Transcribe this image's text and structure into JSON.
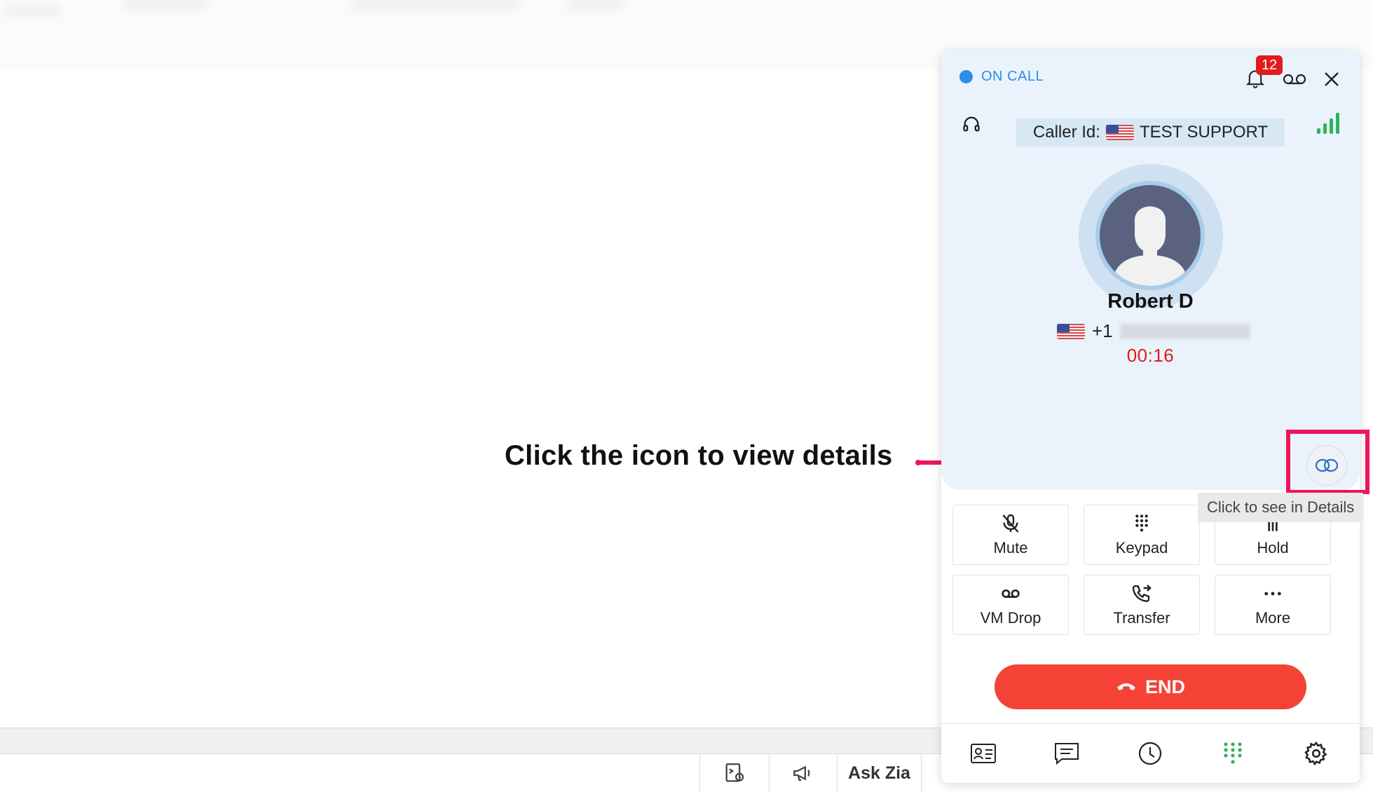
{
  "background": {
    "bottombar": {
      "ask_zia": "Ask Zia"
    }
  },
  "annotation": {
    "text": "Click the icon to view details",
    "color": "#f0145a"
  },
  "phone_panel": {
    "status": {
      "label": "ON CALL",
      "color": "#2b8de6"
    },
    "notifications": {
      "count": "12"
    },
    "icons": [
      "headset-icon",
      "bell-icon",
      "voicemail-icon",
      "close-icon",
      "signal-icon"
    ],
    "caller_id": {
      "prefix": "Caller Id:",
      "value": "TEST SUPPORT"
    },
    "contact": {
      "name": "Robert D",
      "phone_prefix": "+1"
    },
    "timer": {
      "value": "00:16",
      "color": "#e21a1a"
    },
    "details_button": {
      "tooltip": "Click to see in Details"
    },
    "controls": {
      "mute": "Mute",
      "keypad": "Keypad",
      "hold": "Hold",
      "vm_drop": "VM Drop",
      "transfer": "Transfer",
      "more": "More"
    },
    "end_button": {
      "label": "END",
      "color": "#f44336"
    },
    "bottom_nav": [
      "contacts-icon",
      "messages-icon",
      "history-icon",
      "dialpad-icon",
      "settings-icon"
    ]
  }
}
